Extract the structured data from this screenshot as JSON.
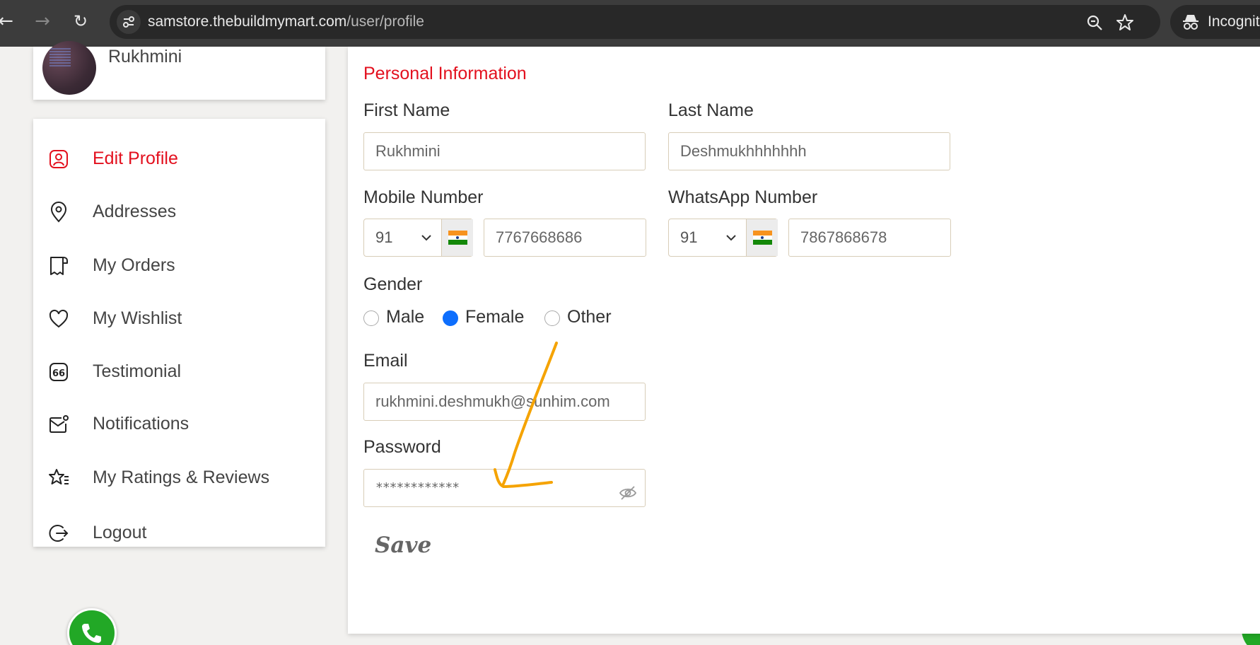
{
  "browser": {
    "url_domain": "samstore.thebuildmymart.com",
    "url_path": "/user/profile",
    "incognito_label": "Incognito"
  },
  "sidebar": {
    "profile_name": "Rukhmini",
    "items": [
      {
        "label": "Edit Profile",
        "icon": "user-square-icon",
        "active": true
      },
      {
        "label": "Addresses",
        "icon": "location-pin-icon"
      },
      {
        "label": "My Orders",
        "icon": "receipt-icon"
      },
      {
        "label": "My Wishlist",
        "icon": "heart-icon"
      },
      {
        "label": "Testimonial",
        "icon": "quote-icon"
      },
      {
        "label": "Notifications",
        "icon": "mail-badge-icon"
      },
      {
        "label": "My Ratings & Reviews",
        "icon": "star-list-icon"
      },
      {
        "label": "Logout",
        "icon": "logout-icon"
      }
    ]
  },
  "form": {
    "section_title": "Personal Information",
    "first_name": {
      "label": "First Name",
      "value": "Rukhmini"
    },
    "last_name": {
      "label": "Last Name",
      "value": "Deshmukhhhhhhh"
    },
    "mobile": {
      "label": "Mobile Number",
      "code": "91",
      "value": "7767668686"
    },
    "whatsapp": {
      "label": "WhatsApp Number",
      "code": "91",
      "value": "7867868678"
    },
    "gender": {
      "label": "Gender",
      "options": [
        "Male",
        "Female",
        "Other"
      ],
      "selected": "Female"
    },
    "email": {
      "label": "Email",
      "value": "rukhmini.deshmukh@sunhim.com"
    },
    "password": {
      "label": "Password",
      "value": "************"
    },
    "save_label": "Save"
  },
  "colors": {
    "accent": "#e3101e",
    "radio_checked": "#0d6efd",
    "annotation": "#f5a300",
    "whatsapp": "#22a826"
  }
}
